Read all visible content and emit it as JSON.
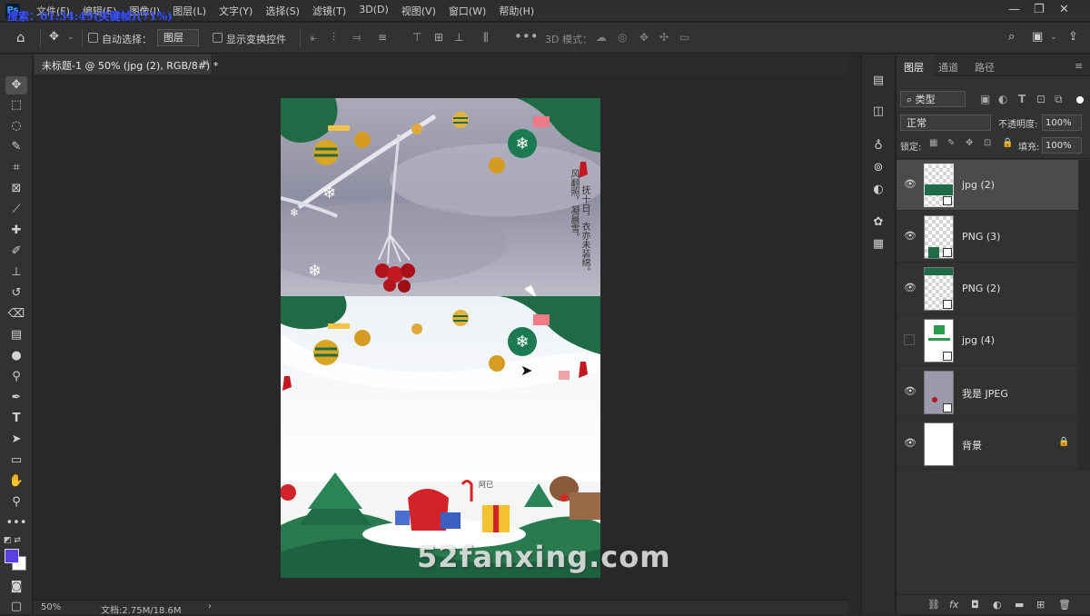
{
  "overlay_search": "搜索：01:34:49(关键帧)(71%)",
  "menu": [
    "文件(F)",
    "编辑(E)",
    "图像(I)",
    "图层(L)",
    "文字(Y)",
    "选择(S)",
    "滤镜(T)",
    "3D(D)",
    "视图(V)",
    "窗口(W)",
    "帮助(H)"
  ],
  "options": {
    "auto_select_label": "自动选择：",
    "auto_select_value": "图层",
    "show_transform_label": "显示变换控件",
    "three_d_mode_label": "3D 模式："
  },
  "document_tab": {
    "title": "未标题-1 @ 50% (jpg (2), RGB/8#) *",
    "close": "×"
  },
  "status": {
    "zoom": "50%",
    "doc_info": "文档:2.75M/18.6M",
    "arrow": "›"
  },
  "canvas_text": {
    "poem_lines": [
      "风翻照，",
      "凝晨雪。",
      "抚十日，",
      "衣亦未装绵。"
    ],
    "small_label": "阿已"
  },
  "watermark": "52fanxing.com",
  "panel": {
    "tabs": [
      "图层",
      "通道",
      "路径"
    ],
    "filter_kind": "类型",
    "blend_mode": "正常",
    "opacity_label": "不透明度:",
    "opacity_value": "100%",
    "lock_label": "锁定:",
    "fill_label": "填充:",
    "fill_value": "100%"
  },
  "layers": [
    {
      "name": "jpg (2)",
      "visible": true,
      "selected": true
    },
    {
      "name": "PNG (3)",
      "visible": true,
      "selected": false
    },
    {
      "name": "PNG (2)",
      "visible": true,
      "selected": false
    },
    {
      "name": "jpg (4)",
      "visible": false,
      "selected": false
    },
    {
      "name": "我是 JPEG",
      "visible": true,
      "selected": false
    },
    {
      "name": "背景",
      "visible": true,
      "selected": false,
      "locked": true
    }
  ],
  "colors": {
    "foreground": "#5b3fe0",
    "background": "#ffffff",
    "accent_green": "#1f6b45"
  }
}
